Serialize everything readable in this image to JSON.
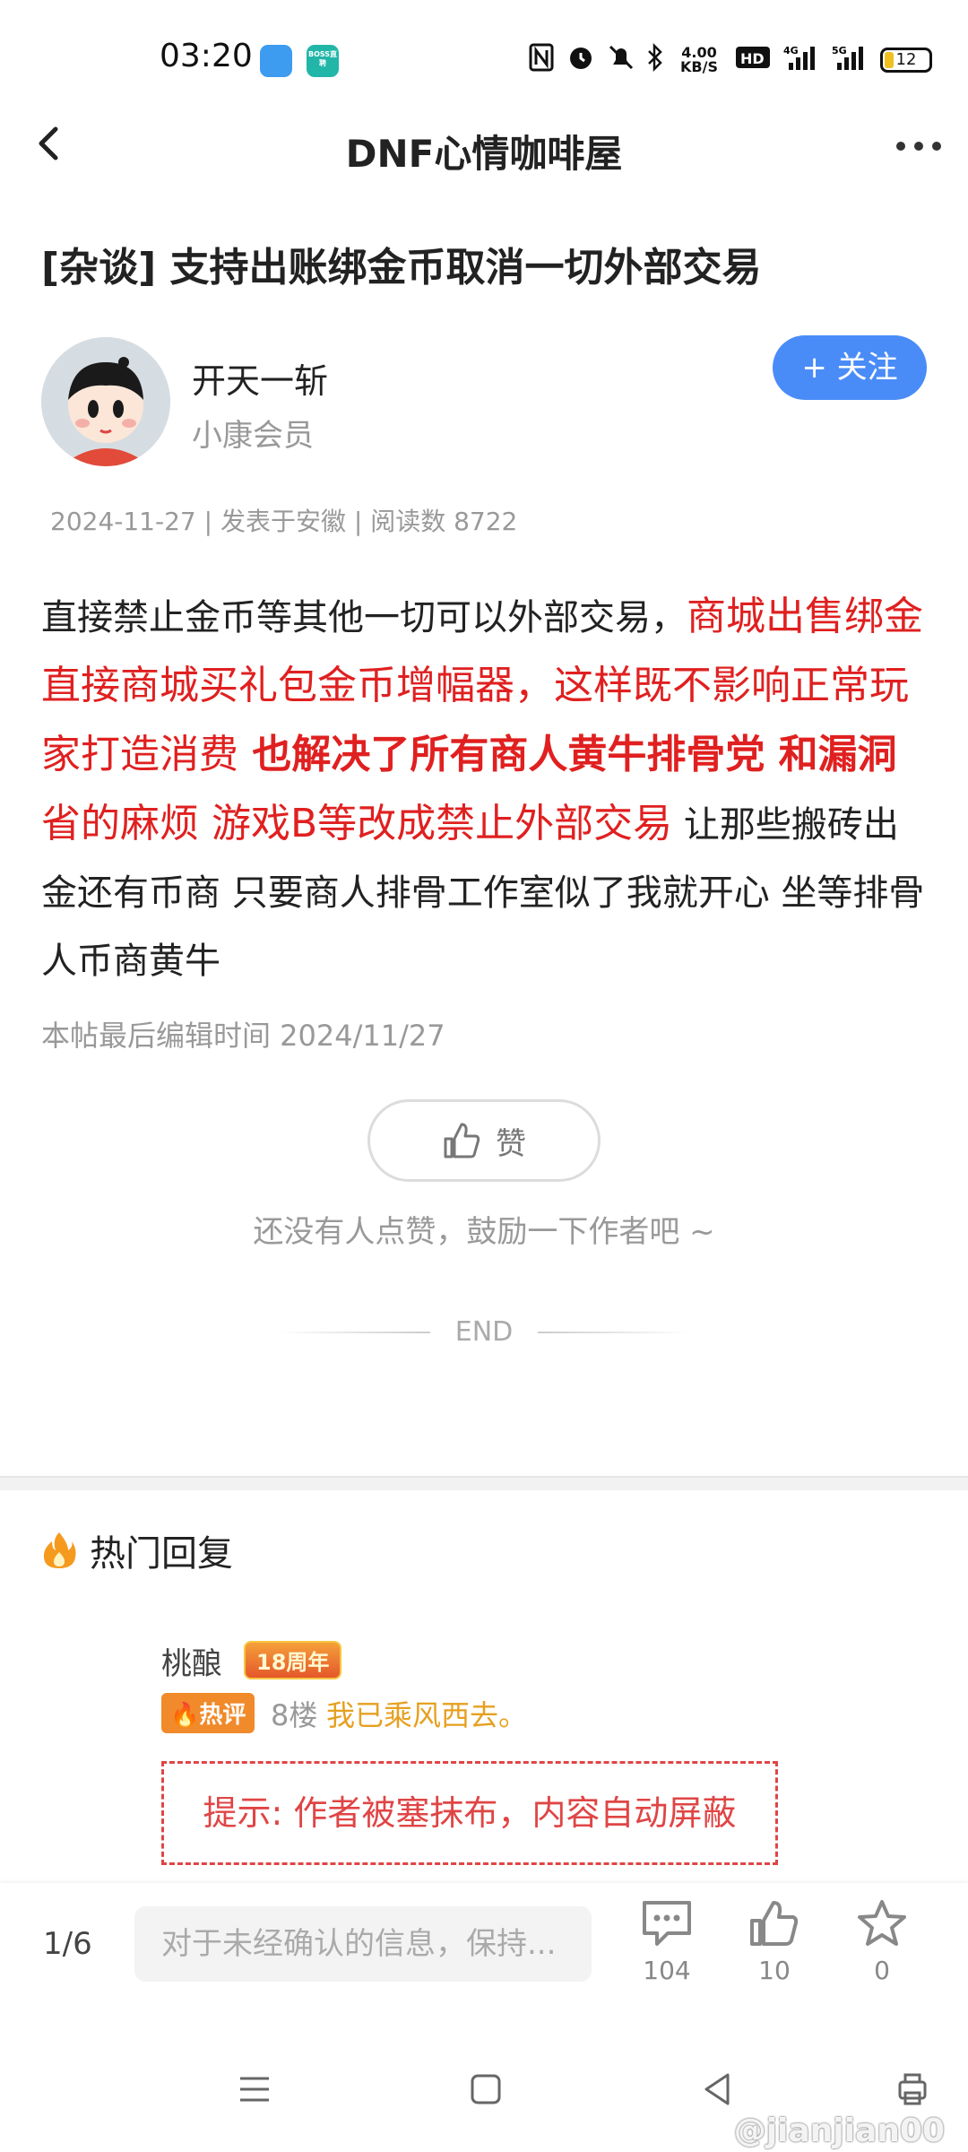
{
  "status_bar": {
    "time": "03:20",
    "boss_label": "BOSS直聘",
    "net_speed": "4.00 KB/S",
    "battery": "12",
    "icons": [
      "nfc-icon",
      "alarm-icon",
      "mute-icon",
      "bluetooth-icon",
      "hd-icon",
      "signal-4g-icon",
      "signal-5g-icon",
      "battery-icon"
    ]
  },
  "header": {
    "title": "DNF心情咖啡屋"
  },
  "post": {
    "title": "[杂谈] 支持出账绑金币取消一切外部交易",
    "author": "开天一斩",
    "member_level": "小康会员",
    "follow_label": "+ 关注",
    "meta": "2024-11-27 | 发表于安徽 | 阅读数 8722",
    "body_p1": "直接禁止金币等其他一切可以外部交易，",
    "body_red1": "商城出售绑金直接商城买礼包金币增幅器，这样既不影响正常玩家打造消费",
    "body_bold1": " 也解决了所有商人黄牛排骨党 和漏洞",
    "body_red2": "  省的麻烦  游戏B等改成禁止外部交易",
    "body_p2": " 让那些搬砖出金还有币商  只要商人排骨工作室似了我就开心  坐等排骨人币商黄牛",
    "edited": "本帖最后编辑时间 2024/11/27",
    "like_label": "赞",
    "like_hint": "还没有人点赞，鼓励一下作者吧 ~",
    "end_label": "END"
  },
  "hot_replies": {
    "title": "热门回复",
    "reply": {
      "user": "桃酿",
      "badge": "18周年",
      "hot_label": "热评",
      "floor": "8楼",
      "content": "我已乘风西去。",
      "blocked_notice": "提示: 作者被塞抹布，内容自动屏蔽"
    }
  },
  "bottom_bar": {
    "page": "1/6",
    "comment_placeholder": "对于未经确认的信息，保持...",
    "comments_count": "104",
    "likes_count": "10",
    "favorites_count": "0"
  },
  "watermark": "@jianjian00",
  "colors": {
    "accent": "#4a8cf7",
    "highlight_red": "#e02020",
    "hot_orange": "#f08a2a"
  }
}
